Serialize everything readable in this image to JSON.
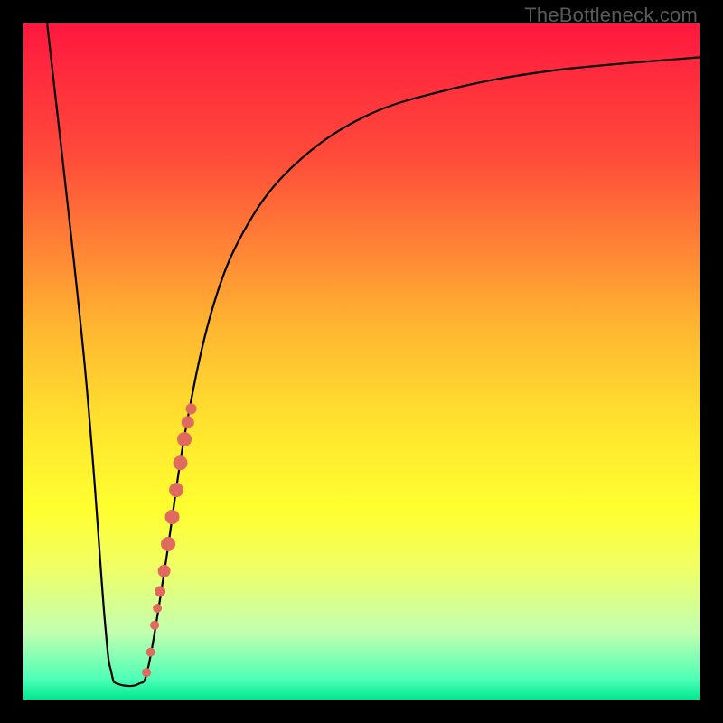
{
  "watermark": "TheBottleneck.com",
  "chart_data": {
    "type": "line",
    "title": "",
    "xlabel": "",
    "ylabel": "",
    "xlim": [
      0,
      100
    ],
    "ylim": [
      0,
      100
    ],
    "gradient_stops": [
      {
        "pct": 0,
        "color": "#ff183f"
      },
      {
        "pct": 20,
        "color": "#ff4c3a"
      },
      {
        "pct": 45,
        "color": "#ffb631"
      },
      {
        "pct": 60,
        "color": "#ffe52e"
      },
      {
        "pct": 72,
        "color": "#ffff30"
      },
      {
        "pct": 80,
        "color": "#f2ff62"
      },
      {
        "pct": 90,
        "color": "#c3ffb0"
      },
      {
        "pct": 97,
        "color": "#4dffb6"
      },
      {
        "pct": 100,
        "color": "#00e98e"
      }
    ],
    "curve": [
      {
        "x": 3.5,
        "y": 100
      },
      {
        "x": 9.0,
        "y": 50
      },
      {
        "x": 12.0,
        "y": 12
      },
      {
        "x": 13.0,
        "y": 4
      },
      {
        "x": 14.0,
        "y": 2.3
      },
      {
        "x": 17.0,
        "y": 2.3
      },
      {
        "x": 18.5,
        "y": 5
      },
      {
        "x": 21.0,
        "y": 20
      },
      {
        "x": 24.0,
        "y": 40
      },
      {
        "x": 28.0,
        "y": 58
      },
      {
        "x": 33.0,
        "y": 70
      },
      {
        "x": 40.0,
        "y": 79
      },
      {
        "x": 50.0,
        "y": 86
      },
      {
        "x": 62.0,
        "y": 90
      },
      {
        "x": 78.0,
        "y": 93
      },
      {
        "x": 100.0,
        "y": 95
      }
    ],
    "points": [
      {
        "x": 18.2,
        "y": 4.0,
        "r": 5
      },
      {
        "x": 18.8,
        "y": 7.0,
        "r": 5
      },
      {
        "x": 19.4,
        "y": 11.0,
        "r": 5
      },
      {
        "x": 19.8,
        "y": 13.5,
        "r": 5
      },
      {
        "x": 20.2,
        "y": 16.0,
        "r": 6
      },
      {
        "x": 20.8,
        "y": 19.0,
        "r": 7
      },
      {
        "x": 21.4,
        "y": 23.0,
        "r": 8
      },
      {
        "x": 22.0,
        "y": 27.0,
        "r": 8
      },
      {
        "x": 22.6,
        "y": 31.0,
        "r": 8
      },
      {
        "x": 23.2,
        "y": 35.0,
        "r": 8
      },
      {
        "x": 23.8,
        "y": 38.5,
        "r": 8
      },
      {
        "x": 24.3,
        "y": 41.0,
        "r": 7
      },
      {
        "x": 24.8,
        "y": 43.0,
        "r": 6
      }
    ],
    "point_color": "#e16a5f",
    "curve_color": "#000000",
    "curve_width": 2.2
  }
}
